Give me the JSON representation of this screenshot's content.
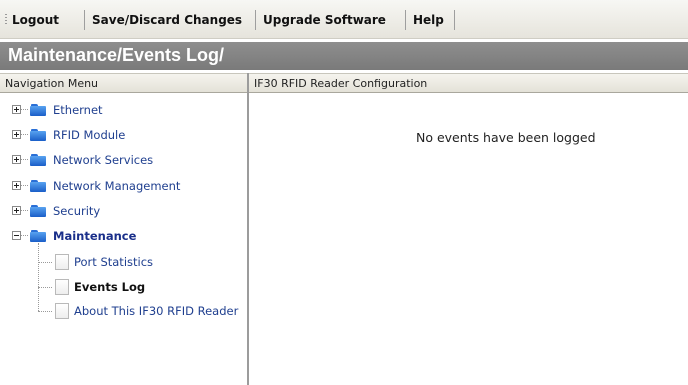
{
  "toolbar": {
    "buttons": [
      {
        "label": "Logout"
      },
      {
        "label": "Save/Discard Changes"
      },
      {
        "label": "Upgrade Software"
      },
      {
        "label": "Help"
      }
    ]
  },
  "page_title": "Maintenance/Events Log/",
  "nav": {
    "header": "Navigation Menu",
    "items": [
      {
        "label": "Ethernet",
        "state": "collapsed"
      },
      {
        "label": "RFID Module",
        "state": "collapsed"
      },
      {
        "label": "Network Services",
        "state": "collapsed"
      },
      {
        "label": "Network Management",
        "state": "collapsed"
      },
      {
        "label": "Security",
        "state": "collapsed"
      },
      {
        "label": "Maintenance",
        "state": "expanded",
        "selected": true
      }
    ],
    "children": [
      {
        "label": "Port Statistics"
      },
      {
        "label": "Events Log",
        "selected": true
      },
      {
        "label": "About This IF30 RFID Reader"
      }
    ]
  },
  "content": {
    "header": "IF30 RFID Reader Configuration",
    "message": "No events have been logged"
  },
  "colors": {
    "title_band": "#7f7f7f",
    "folder_blue": "#2a6fd6",
    "link_text": "#1f3f8f"
  },
  "icons": {
    "expand": "plus-box-icon",
    "collapse": "minus-box-icon",
    "folder": "folder-icon",
    "page": "page-icon"
  }
}
